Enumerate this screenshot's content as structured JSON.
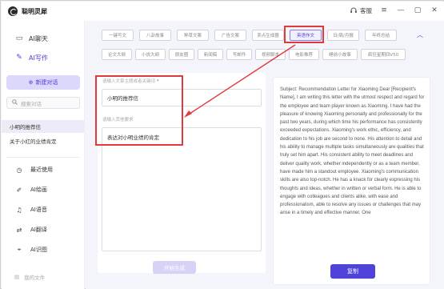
{
  "app": {
    "title": "聪明灵犀",
    "service_label": "客服"
  },
  "sidebar": {
    "nav": [
      {
        "label": "AI聊天",
        "icon": "chat-icon"
      },
      {
        "label": "AI写作",
        "icon": "pen-icon"
      }
    ],
    "new_chat_label": "新建对话",
    "search_placeholder": "搜索对话",
    "conversations": [
      "小明的推荐信",
      "关于小红的业绩肯定"
    ],
    "tools": [
      {
        "label": "最近使用",
        "icon": "clock-icon"
      },
      {
        "label": "AI绘画",
        "icon": "paint-icon"
      },
      {
        "label": "AI语音",
        "icon": "voice-icon"
      },
      {
        "label": "AI翻译",
        "icon": "translate-icon"
      },
      {
        "label": "AI识图",
        "icon": "image-recognition-icon"
      }
    ],
    "my_files_label": "我的文件"
  },
  "categories": {
    "row1": [
      "一键写文",
      "八卦故事",
      "种草文案",
      "广告文案",
      "卖点生成器",
      "英语作文",
      "日/周/月报",
      "年终总结"
    ],
    "row2": [
      "论文大纲",
      "小说大纲",
      "朋友圈",
      "新闻稿",
      "写邮件",
      "视频脚本",
      "电影推荐",
      "睡前小故事",
      "疯狂星期四V50"
    ],
    "selected": "英语作文"
  },
  "form": {
    "subject_label": "请输入文章主题或者关键词",
    "subject_required_mark": "*",
    "subject_value": "小明的推荐信",
    "other_label": "请输入其他要求",
    "other_value": "表达对小明业绩的肯定",
    "generate_label": "开始生成"
  },
  "result": {
    "text": "Subject: Recommendation Letter for Xiaoming Dear [Recipient's Name], I am writing this letter with the utmost respect and regard for the employee and team player known as Xiaoming. I have had the pleasure of knowing Xiaoming personally and professionally for the past two years, during which time his performance has consistently exceeded expectations. Xiaoming's work ethic, efficiency, and dedication to his job are second to none. His attention to detail and his ability to manage multiple tasks simultaneously are qualities that truly set him apart. His consistent ability to meet deadlines and deliver quality work, whether independently or as a team member, have made him a standout employee. Xiaoming's communication skills are also top-notch. He has a knack for clearly expressing his thoughts and ideas, whether in written or verbal form. He is able to engage with colleagues and clients alike, with ease and professionalism, able to resolve any issues or challenges that may arise in a timely and effective manner. One",
    "copy_label": "复制"
  }
}
